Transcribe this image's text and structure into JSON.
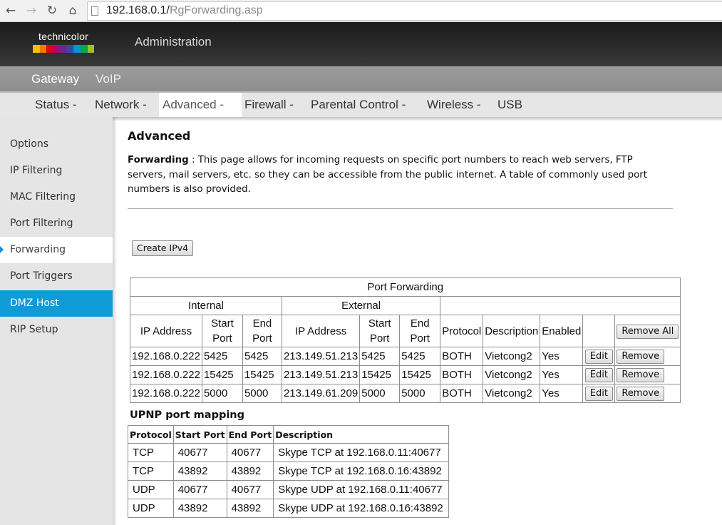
{
  "browser": {
    "url_host": "192.168.0.1/",
    "url_path": "RgForwarding.asp"
  },
  "header": {
    "brand": "technicolor",
    "title": "Administration",
    "brand_colors": [
      "#f2c200",
      "#f07b00",
      "#e2001a",
      "#b5007a",
      "#6a2a8c",
      "#2b4fa8",
      "#0093d6",
      "#00a651",
      "#9bc31c"
    ]
  },
  "subnav": {
    "items": [
      {
        "label": "Gateway"
      },
      {
        "label": "VoIP"
      }
    ]
  },
  "mainnav": {
    "items": [
      {
        "label": "Status -"
      },
      {
        "label": "Network -"
      },
      {
        "label": "Advanced -"
      },
      {
        "label": "Firewall -"
      },
      {
        "label": "Parental Control -"
      },
      {
        "label": "Wireless -"
      },
      {
        "label": "USB"
      }
    ],
    "active": "Advanced -"
  },
  "sidebar": {
    "items": [
      {
        "label": "Options"
      },
      {
        "label": "IP Filtering"
      },
      {
        "label": "MAC Filtering"
      },
      {
        "label": "Port Filtering"
      },
      {
        "label": "Forwarding"
      },
      {
        "label": "Port Triggers"
      },
      {
        "label": "DMZ Host"
      },
      {
        "label": "RIP Setup"
      }
    ],
    "current": "Forwarding",
    "highlight": "DMZ Host",
    "highlight_color": "#0f9bd7"
  },
  "main": {
    "title": "Advanced",
    "desc_label": "Forwarding",
    "desc_sep": " : ",
    "desc_text": " This page allows for incoming requests on specific port numbers to reach web servers, FTP servers, mail servers, etc. so they can be accessible from the public internet. A table of commonly used port numbers is also provided.",
    "create_button": "Create IPv4"
  },
  "port_forwarding": {
    "title": "Port Forwarding",
    "group_internal": "Internal",
    "group_external": "External",
    "headers": {
      "int_ip": "IP Address",
      "int_start_1": "Start",
      "int_start_2": "Port",
      "int_end_1": "End",
      "int_end_2": "Port",
      "ext_ip": "IP Address",
      "ext_start_1": "Start",
      "ext_start_2": "Port",
      "ext_end_1": "End",
      "ext_end_2": "Port",
      "protocol": "Protocol",
      "description": "Description",
      "enabled": "Enabled",
      "remove_all": "Remove All"
    },
    "rows": [
      {
        "int_ip": "192.168.0.222",
        "int_start": "5425",
        "int_end": "5425",
        "ext_ip": "213.149.51.213",
        "ext_start": "5425",
        "ext_end": "5425",
        "protocol": "BOTH",
        "description": "Vietcong2",
        "enabled": "Yes",
        "edit": "Edit",
        "remove": "Remove"
      },
      {
        "int_ip": "192.168.0.222",
        "int_start": "15425",
        "int_end": "15425",
        "ext_ip": "213.149.51.213",
        "ext_start": "15425",
        "ext_end": "15425",
        "protocol": "BOTH",
        "description": "Vietcong2",
        "enabled": "Yes",
        "edit": "Edit",
        "remove": "Remove"
      },
      {
        "int_ip": "192.168.0.222",
        "int_start": "5000",
        "int_end": "5000",
        "ext_ip": "213.149.61.209",
        "ext_start": "5000",
        "ext_end": "5000",
        "protocol": "BOTH",
        "description": "Vietcong2",
        "enabled": "Yes",
        "edit": "Edit",
        "remove": "Remove"
      }
    ]
  },
  "upnp": {
    "title": "UPNP port mapping",
    "headers": {
      "protocol": "Protocol",
      "start": "Start Port",
      "end": "End Port",
      "description": "Description"
    },
    "rows": [
      {
        "protocol": "TCP",
        "start": "40677",
        "end": "40677",
        "description": "Skype TCP at 192.168.0.11:40677"
      },
      {
        "protocol": "TCP",
        "start": "43892",
        "end": "43892",
        "description": "Skype TCP at 192.168.0.16:43892"
      },
      {
        "protocol": "UDP",
        "start": "40677",
        "end": "40677",
        "description": "Skype UDP at 192.168.0.11:40677"
      },
      {
        "protocol": "UDP",
        "start": "43892",
        "end": "43892",
        "description": "Skype UDP at 192.168.0.16:43892"
      }
    ]
  }
}
